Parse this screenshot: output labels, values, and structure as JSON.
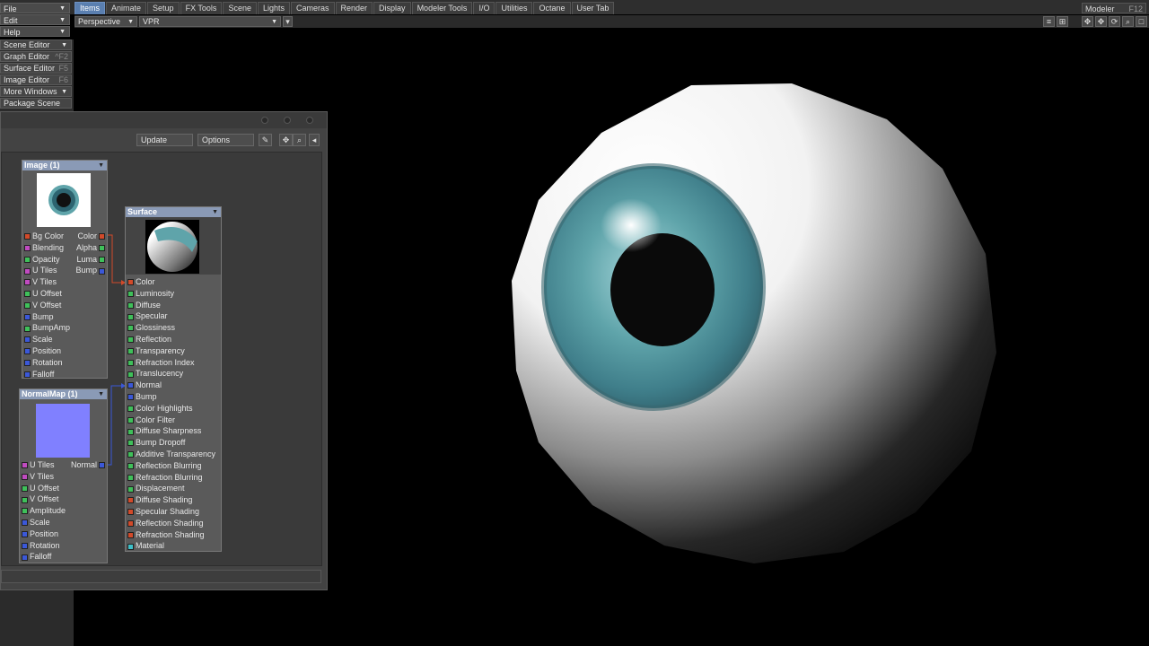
{
  "menus": {
    "file": "File",
    "edit": "Edit",
    "help": "Help"
  },
  "tabs": [
    "Items",
    "Animate",
    "Setup",
    "FX Tools",
    "Scene",
    "Lights",
    "Cameras",
    "Render",
    "Display",
    "Modeler Tools",
    "I/O",
    "Utilities",
    "Octane",
    "User Tab"
  ],
  "active_tab": "Items",
  "modeler": {
    "label": "Modeler",
    "key": "F12"
  },
  "viewport": {
    "view_mode": "Perspective",
    "render_mode": "VPR"
  },
  "left_menu": [
    {
      "label": "Scene Editor",
      "key": ""
    },
    {
      "label": "Graph Editor",
      "key": "^F2"
    },
    {
      "label": "Surface Editor",
      "key": "F5"
    },
    {
      "label": "Image Editor",
      "key": "F6"
    },
    {
      "label": "More Windows",
      "key": ""
    },
    {
      "label": "Package Scene",
      "key": ""
    }
  ],
  "node_editor": {
    "update_label": "Update",
    "options_label": "Options",
    "nodes": {
      "image": {
        "title": "Image (1)",
        "inputs": [
          {
            "label": "Bg Color",
            "color": "#d24a2a"
          },
          {
            "label": "Blending",
            "color": "#c04bc0"
          },
          {
            "label": "Opacity",
            "color": "#3fc05a"
          },
          {
            "label": "U Tiles",
            "color": "#c04bc0"
          },
          {
            "label": "V Tiles",
            "color": "#c04bc0"
          },
          {
            "label": "U Offset",
            "color": "#3fc05a"
          },
          {
            "label": "V Offset",
            "color": "#3fc05a"
          },
          {
            "label": "Bump",
            "color": "#3b58d8"
          },
          {
            "label": "BumpAmp",
            "color": "#3fc05a"
          },
          {
            "label": "Scale",
            "color": "#3b58d8"
          },
          {
            "label": "Position",
            "color": "#3b58d8"
          },
          {
            "label": "Rotation",
            "color": "#3b58d8"
          },
          {
            "label": "Falloff",
            "color": "#3b58d8"
          }
        ],
        "outputs": [
          {
            "label": "Color",
            "color": "#d24a2a"
          },
          {
            "label": "Alpha",
            "color": "#3fc05a"
          },
          {
            "label": "Luma",
            "color": "#3fc05a"
          },
          {
            "label": "Bump",
            "color": "#3b58d8"
          }
        ]
      },
      "normalmap": {
        "title": "NormalMap (1)",
        "inputs": [
          {
            "label": "U Tiles",
            "color": "#c04bc0"
          },
          {
            "label": "V Tiles",
            "color": "#c04bc0"
          },
          {
            "label": "U Offset",
            "color": "#3fc05a"
          },
          {
            "label": "V Offset",
            "color": "#3fc05a"
          },
          {
            "label": "Amplitude",
            "color": "#3fc05a"
          },
          {
            "label": "Scale",
            "color": "#3b58d8"
          },
          {
            "label": "Position",
            "color": "#3b58d8"
          },
          {
            "label": "Rotation",
            "color": "#3b58d8"
          },
          {
            "label": "Falloff",
            "color": "#3b58d8"
          }
        ],
        "outputs": [
          {
            "label": "Normal",
            "color": "#3b58d8"
          }
        ]
      },
      "surface": {
        "title": "Surface",
        "inputs": [
          {
            "label": "Color",
            "color": "#d24a2a"
          },
          {
            "label": "Luminosity",
            "color": "#3fc05a"
          },
          {
            "label": "Diffuse",
            "color": "#3fc05a"
          },
          {
            "label": "Specular",
            "color": "#3fc05a"
          },
          {
            "label": "Glossiness",
            "color": "#3fc05a"
          },
          {
            "label": "Reflection",
            "color": "#3fc05a"
          },
          {
            "label": "Transparency",
            "color": "#3fc05a"
          },
          {
            "label": "Refraction Index",
            "color": "#3fc05a"
          },
          {
            "label": "Translucency",
            "color": "#3fc05a"
          },
          {
            "label": "Normal",
            "color": "#3b58d8"
          },
          {
            "label": "Bump",
            "color": "#3b58d8"
          },
          {
            "label": "Color Highlights",
            "color": "#3fc05a"
          },
          {
            "label": "Color Filter",
            "color": "#3fc05a"
          },
          {
            "label": "Diffuse Sharpness",
            "color": "#3fc05a"
          },
          {
            "label": "Bump Dropoff",
            "color": "#3fc05a"
          },
          {
            "label": "Additive Transparency",
            "color": "#3fc05a"
          },
          {
            "label": "Reflection Blurring",
            "color": "#3fc05a"
          },
          {
            "label": "Refraction Blurring",
            "color": "#3fc05a"
          },
          {
            "label": "Displacement",
            "color": "#3fc05a"
          },
          {
            "label": "Diffuse Shading",
            "color": "#d24a2a"
          },
          {
            "label": "Specular Shading",
            "color": "#d24a2a"
          },
          {
            "label": "Reflection Shading",
            "color": "#d24a2a"
          },
          {
            "label": "Refraction Shading",
            "color": "#d24a2a"
          },
          {
            "label": "Material",
            "color": "#3ec0c8"
          }
        ]
      }
    }
  },
  "colors": {
    "accent_tab": "#5a7fb0",
    "node_header": "#8a9ab6",
    "iris": "#5fa4aa"
  }
}
